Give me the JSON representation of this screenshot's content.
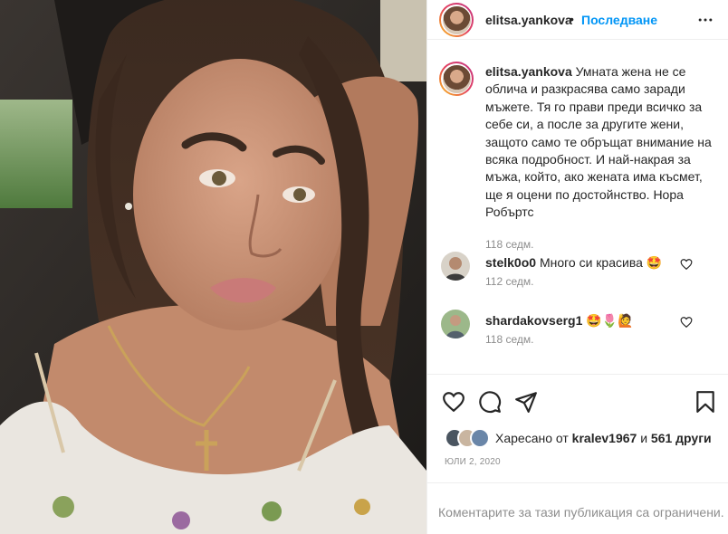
{
  "header": {
    "username": "elitsa.yankova",
    "dot": "•",
    "follow_label": "Последване"
  },
  "caption": {
    "username": "elitsa.yankova",
    "text": "Умната жена не се облича и разкрасява само заради мъжете. Тя го прави преди всичко за себе си, а после за другите жени, защото само те обръщат внимание на всяка подробност. И най-накрая за мъжа, който, ако жената има късмет, ще я оцени по достойнство. Нора Робъртс",
    "time": "118 седм."
  },
  "comments": [
    {
      "username": "stelk0o0",
      "text": "Много си красива 🤩",
      "time": "112 седм."
    },
    {
      "username": "shardakovserg1",
      "text": "🤩🌷🙋",
      "time": "118 седм."
    }
  ],
  "likes": {
    "prefix": "Харесано от",
    "user": "kralev1967",
    "conj": "и",
    "others": "561 други"
  },
  "date": "юли 2, 2020",
  "footer": {
    "restricted": "Коментарите за тази публикация са ограничени."
  },
  "colors": {
    "link": "#0095f6",
    "muted": "#8e8e8e",
    "text": "#262626"
  }
}
